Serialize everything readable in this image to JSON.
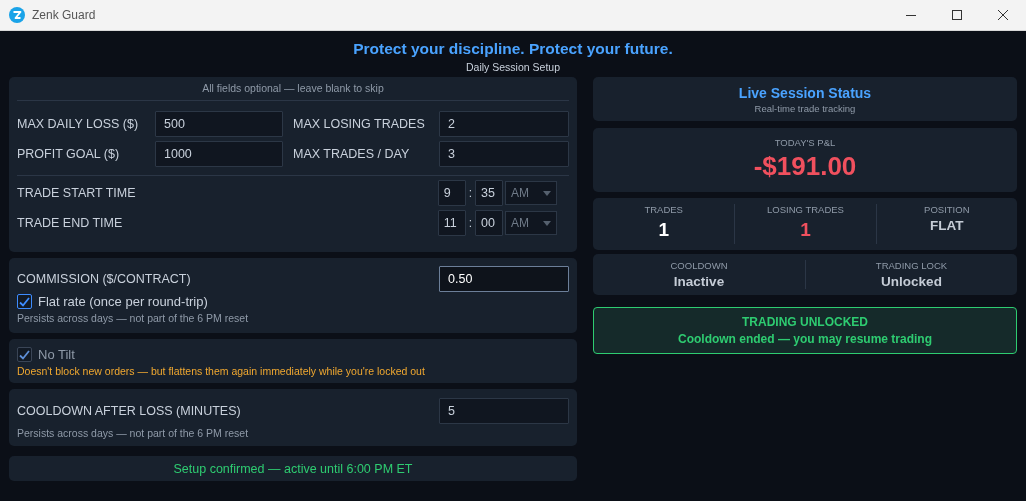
{
  "window": {
    "title": "Zenk Guard"
  },
  "header": {
    "title": "Protect your discipline. Protect your future.",
    "subtitle": "Daily Session Setup"
  },
  "limits": {
    "note": "All fields optional — leave blank to skip",
    "fields": [
      {
        "label": "MAX DAILY LOSS ($)",
        "value": "500"
      },
      {
        "label": "MAX LOSING TRADES",
        "value": "2"
      },
      {
        "label": "PROFIT GOAL ($)",
        "value": "1000"
      },
      {
        "label": "MAX TRADES / DAY",
        "value": "3"
      }
    ],
    "times": [
      {
        "label": "TRADE START TIME",
        "hour": "9",
        "separator": ":",
        "minute": "35",
        "period": "AM"
      },
      {
        "label": "TRADE END TIME",
        "hour": "11",
        "separator": ":",
        "minute": "00",
        "period": "AM"
      }
    ]
  },
  "commission": {
    "label": "COMMISSION ($/CONTRACT)",
    "value": "0.50",
    "focused": true,
    "flat_rate": {
      "label": "Flat rate (once per round-trip)",
      "checked": true,
      "disabled": false
    },
    "note": "Persists across days — not part of the 6 PM reset"
  },
  "no_tilt": {
    "label": "No Tilt",
    "checked": true,
    "disabled": true,
    "warning": "Doesn't block new orders — but flattens them again immediately while you're locked out"
  },
  "cooldown": {
    "label": "COOLDOWN AFTER LOSS (MINUTES)",
    "value": "5",
    "focused": false,
    "note": "Persists across days — not part of the 6 PM reset"
  },
  "footer": "Setup confirmed — active until 6:00 PM ET",
  "status": {
    "title": "Live Session Status",
    "subtitle": "Real-time trade tracking",
    "pnl": {
      "label": "TODAY'S P&L",
      "value": "-$191.00",
      "color": "#f0505e"
    },
    "stats": [
      {
        "label": "TRADES",
        "value": "1",
        "color": "#ffffff"
      },
      {
        "label": "LOSING TRADES",
        "value": "1",
        "color": "#f0505e"
      },
      {
        "label": "POSITION",
        "value": "FLAT",
        "color": "#c5ccd6"
      }
    ],
    "states": [
      {
        "label": "COOLDOWN",
        "value": "Inactive"
      },
      {
        "label": "TRADING LOCK",
        "value": "Unlocked"
      }
    ],
    "banner": {
      "kind": "unlocked",
      "title": "TRADING UNLOCKED",
      "message": "Cooldown ended — you may resume trading"
    }
  }
}
